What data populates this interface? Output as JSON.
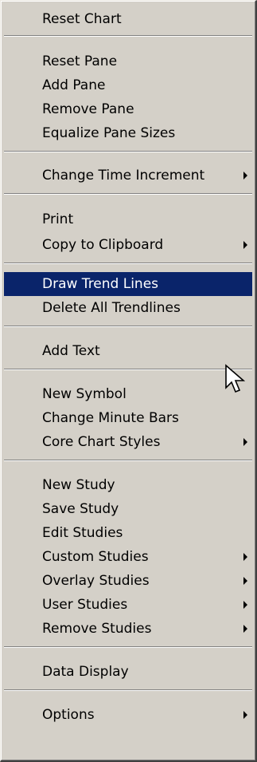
{
  "menu": {
    "items": [
      {
        "label": "Reset Chart"
      },
      {
        "label": "Reset Pane"
      },
      {
        "label": "Add Pane"
      },
      {
        "label": "Remove Pane"
      },
      {
        "label": "Equalize Pane Sizes"
      },
      {
        "label": "Change Time Increment",
        "submenu": true
      },
      {
        "label": "Print"
      },
      {
        "label": "Copy to Clipboard",
        "submenu": true
      },
      {
        "label": "Draw Trend Lines",
        "highlighted": true
      },
      {
        "label": "Delete All Trendlines"
      },
      {
        "label": "Add Text"
      },
      {
        "label": "New Symbol"
      },
      {
        "label": "Change Minute Bars"
      },
      {
        "label": "Core Chart Styles",
        "submenu": true
      },
      {
        "label": "New Study"
      },
      {
        "label": "Save Study"
      },
      {
        "label": "Edit Studies"
      },
      {
        "label": "Custom Studies",
        "submenu": true
      },
      {
        "label": "Overlay Studies",
        "submenu": true
      },
      {
        "label": "User Studies",
        "submenu": true
      },
      {
        "label": "Remove Studies",
        "submenu": true
      },
      {
        "label": "Data Display"
      },
      {
        "label": "Options",
        "submenu": true
      }
    ]
  },
  "colors": {
    "menu_bg": "#d4d0c8",
    "highlight_bg": "#0a246a",
    "highlight_text": "#ffffff"
  },
  "icons": {
    "submenu": "submenu-arrow-icon",
    "cursor": "mouse-pointer-icon"
  }
}
